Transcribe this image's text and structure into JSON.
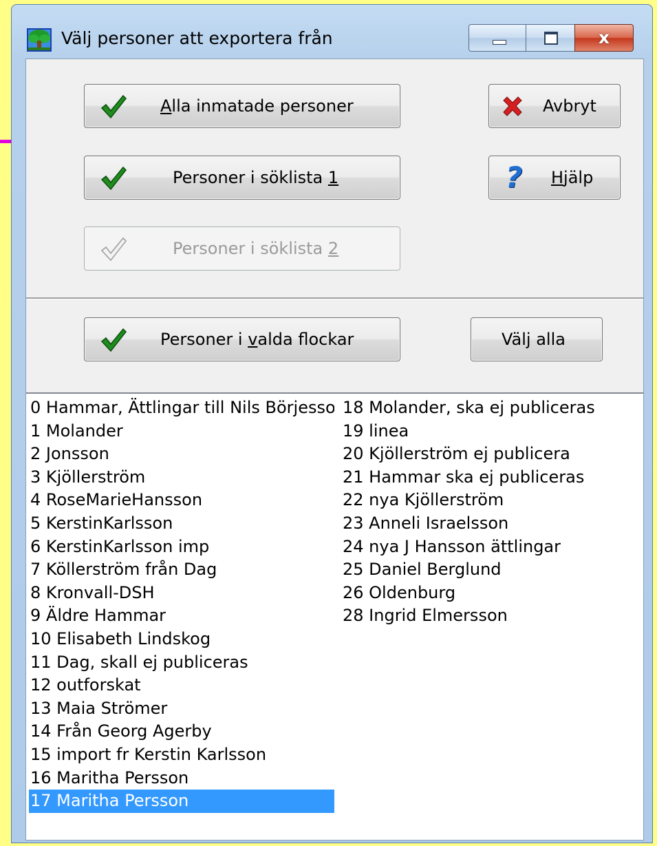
{
  "window": {
    "title": "Välj personer att exportera från",
    "icon": "tree-app-icon",
    "caption_buttons": [
      "minimize",
      "maximize",
      "close"
    ],
    "close_glyph": "x"
  },
  "buttons": {
    "all_persons": {
      "pre": "",
      "accel": "A",
      "post": "lla inmatade personer",
      "icon": "check-icon",
      "enabled": true
    },
    "search_list_1": {
      "pre": "Personer i söklista ",
      "accel": "1",
      "post": "",
      "icon": "check-icon",
      "enabled": true
    },
    "search_list_2": {
      "pre": "Personer i söklista ",
      "accel": "2",
      "post": "",
      "icon": "check-icon",
      "enabled": false
    },
    "cancel": {
      "label": "Avbryt",
      "icon": "x-icon",
      "enabled": true
    },
    "help": {
      "pre": "",
      "accel": "H",
      "post": "jälp",
      "icon": "question-icon",
      "enabled": true
    },
    "selected_flocks": {
      "pre": "Personer i ",
      "accel": "v",
      "post": "alda flockar",
      "icon": "check-icon",
      "enabled": true
    },
    "select_all": {
      "label": "Välj alla",
      "enabled": true
    }
  },
  "flock_list": {
    "selected_index": 17,
    "column1": [
      "0  Hammar, Ättlingar till Nils Börjesso",
      "1  Molander",
      "2  Jonsson",
      "3  Kjöllerström",
      "4  RoseMarieHansson",
      "5  KerstinKarlsson",
      "6  KerstinKarlsson imp",
      "7  Köllerström från Dag",
      "8  Kronvall-DSH",
      "9  Äldre Hammar",
      "10  Elisabeth Lindskog",
      "11  Dag, skall ej publiceras",
      "12  outforskat",
      "13  Maia Strömer",
      "14  Från Georg Agerby",
      "15  import fr Kerstin Karlsson",
      "16  Maritha Persson",
      "17  Maritha Persson"
    ],
    "column2": [
      "18  Molander, ska ej publiceras",
      "19  linea",
      "20  Kjöllerström ej publicera",
      "21  Hammar ska ej publiceras",
      "22  nya Kjöllerström",
      "23  Anneli Israelsson",
      "24  nya J Hansson ättlingar",
      "25  Daniel Berglund",
      "26  Oldenburg",
      "28  Ingrid Elmersson"
    ]
  },
  "colors": {
    "desktop_bg": "#ffff88",
    "selection_bg": "#3399ff",
    "check_green": "#1e8c1e",
    "cancel_red": "#d42020",
    "help_blue": "#1f6fd1"
  }
}
